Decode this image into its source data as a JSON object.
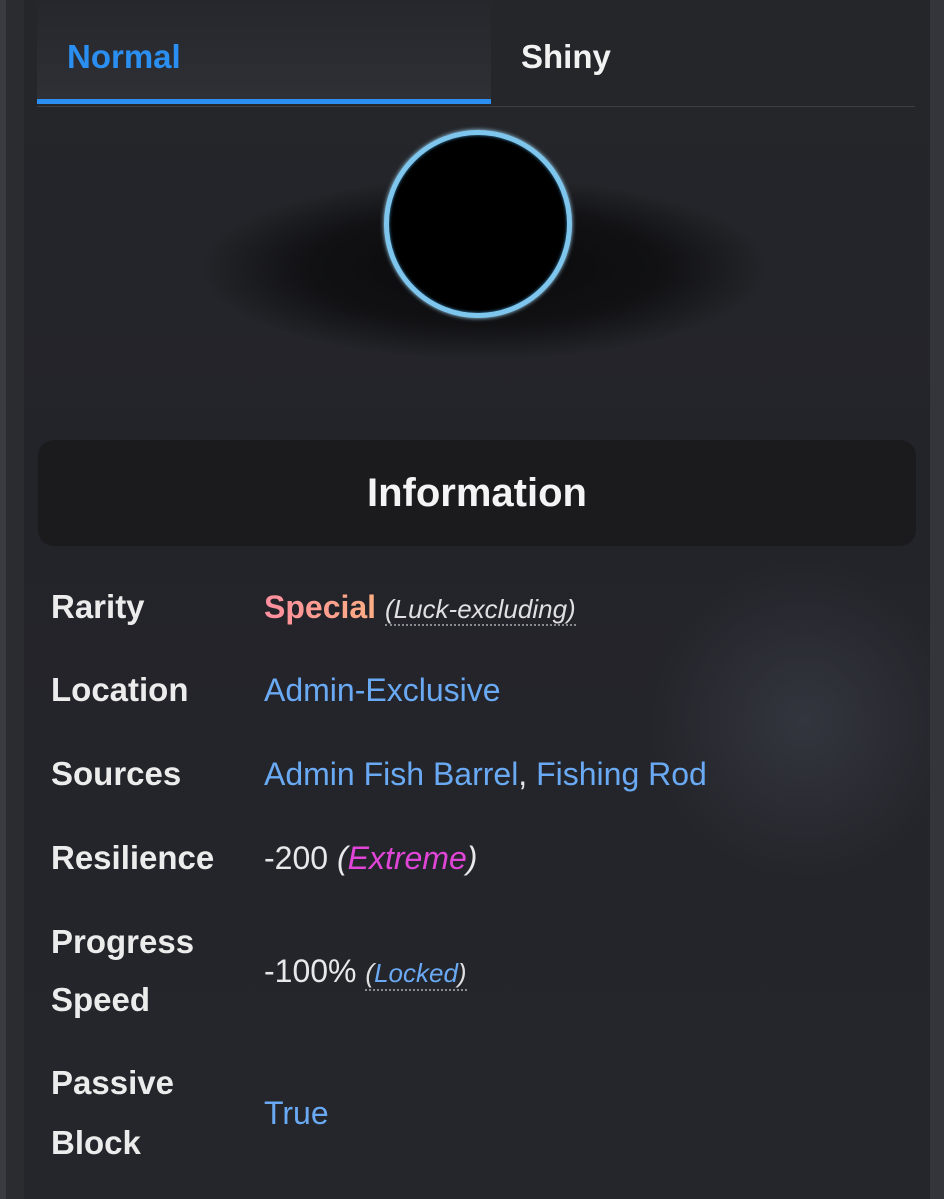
{
  "tabs": [
    {
      "label": "Normal",
      "active": true
    },
    {
      "label": "Shiny",
      "active": false
    }
  ],
  "colors": {
    "accent": "#2a8ff0",
    "link": "#6aaaf4",
    "extreme": "#e045d8",
    "special_start": "#ff8ea0",
    "special_end": "#ffae82",
    "ring": "#7fc6ee"
  },
  "icons": {
    "hero": "black-ball-fish-image"
  },
  "info": {
    "title": "Information",
    "rarity": {
      "label": "Rarity",
      "value": "Special",
      "note": "(Luck-excluding)"
    },
    "location": {
      "label": "Location",
      "value": "Admin-Exclusive"
    },
    "sources": {
      "label": "Sources",
      "items": [
        "Admin Fish Barrel",
        "Fishing Rod"
      ],
      "separator": ","
    },
    "resilience": {
      "label": "Resilience",
      "value": "-200",
      "paren_open": "(",
      "tier": "Extreme",
      "paren_close": ")"
    },
    "progress_speed": {
      "label_line1": "Progress",
      "label_line2": "Speed",
      "value": "-100%",
      "note_open": "(",
      "note": "Locked",
      "note_close": ")"
    },
    "passive_block": {
      "label_line1": "Passive",
      "label_line2": "Block",
      "value": "True"
    }
  }
}
